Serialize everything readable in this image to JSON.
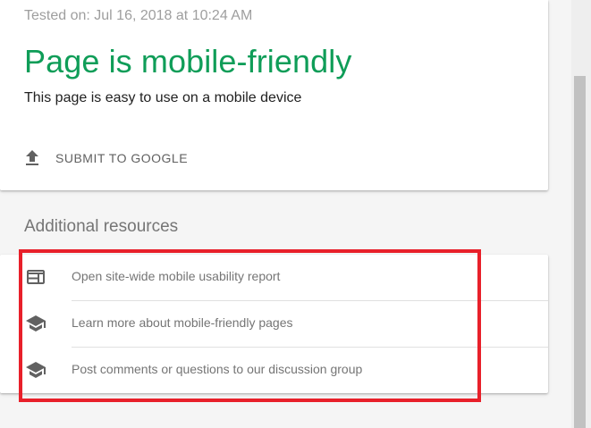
{
  "result": {
    "tested_on": "Tested on: Jul 16, 2018 at 10:24 AM",
    "status_title": "Page is mobile-friendly",
    "status_description": "This page is easy to use on a mobile device",
    "submit_label": "SUBMIT TO GOOGLE",
    "submit_icon": "upload-icon"
  },
  "resources": {
    "heading": "Additional resources",
    "items": [
      {
        "icon": "web-layout-icon",
        "label": "Open site-wide mobile usability report"
      },
      {
        "icon": "school-icon",
        "label": "Learn more about mobile-friendly pages"
      },
      {
        "icon": "school-icon",
        "label": "Post comments or questions to our discussion group"
      }
    ]
  },
  "colors": {
    "success_green": "#0f9d58",
    "highlight_red": "#e8202a",
    "icon_gray": "#616161",
    "text_gray": "#757575"
  }
}
